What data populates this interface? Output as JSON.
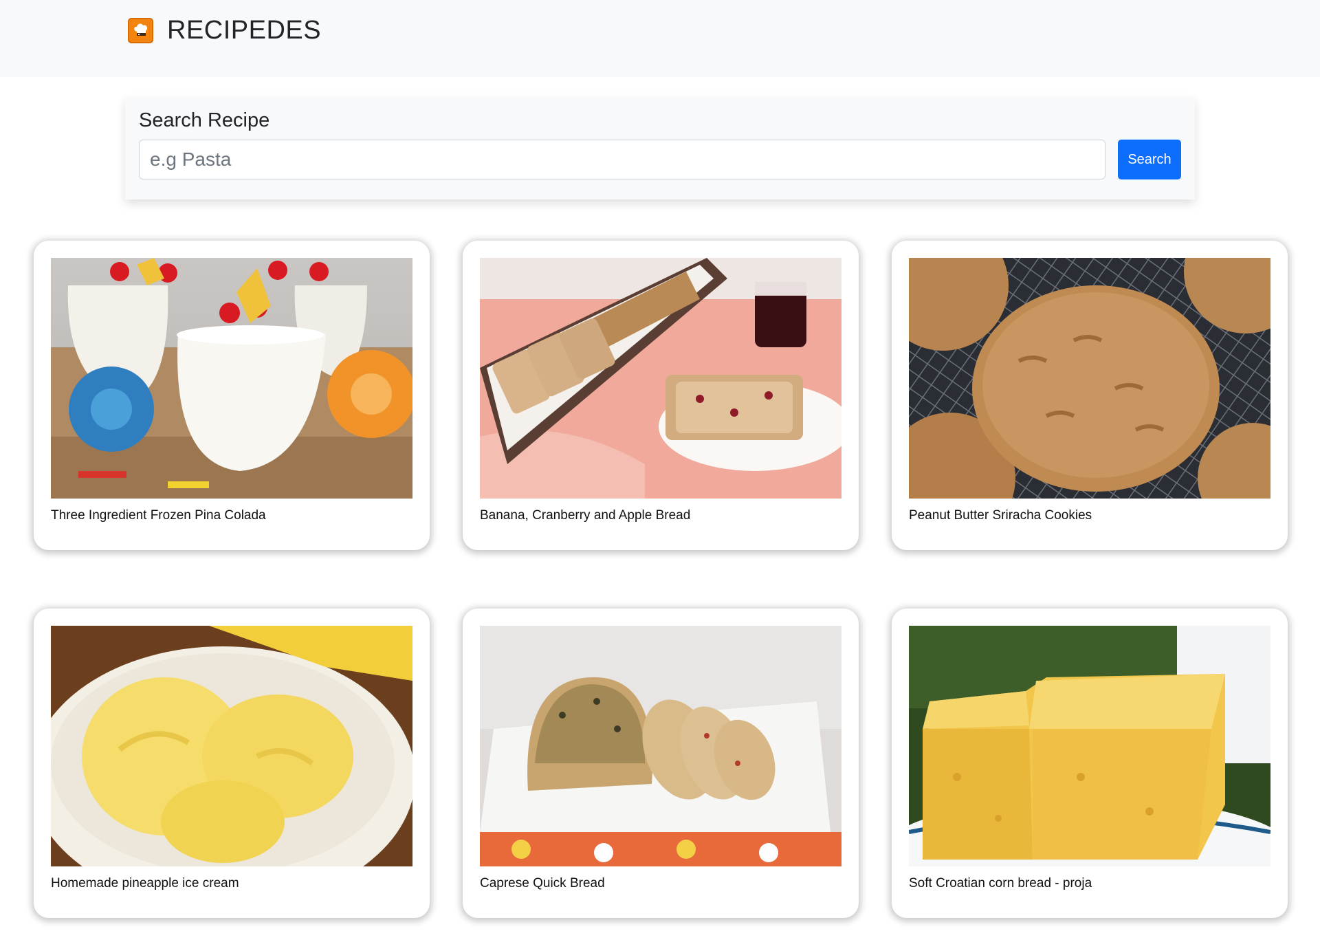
{
  "navbar": {
    "brand": "RECIPEDES",
    "logo_icon": "chef-hat-icon",
    "background": "#f8f9fa",
    "logo_color": "#f2840f"
  },
  "search": {
    "label": "Search Recipe",
    "placeholder": "e.g Pasta",
    "value": "",
    "button_label": "Search",
    "button_color": "#0d6efd"
  },
  "recipes": [
    {
      "title": "Three Ingredient Frozen Pina Colada",
      "image": "pina-colada-photo"
    },
    {
      "title": "Banana, Cranberry and Apple Bread",
      "image": "banana-bread-photo"
    },
    {
      "title": "Peanut Butter Sriracha Cookies",
      "image": "cookies-photo"
    },
    {
      "title": "Homemade pineapple ice cream",
      "image": "ice-cream-photo"
    },
    {
      "title": "Caprese Quick Bread",
      "image": "caprese-bread-photo"
    },
    {
      "title": "Soft Croatian corn bread - proja",
      "image": "corn-bread-photo"
    }
  ]
}
